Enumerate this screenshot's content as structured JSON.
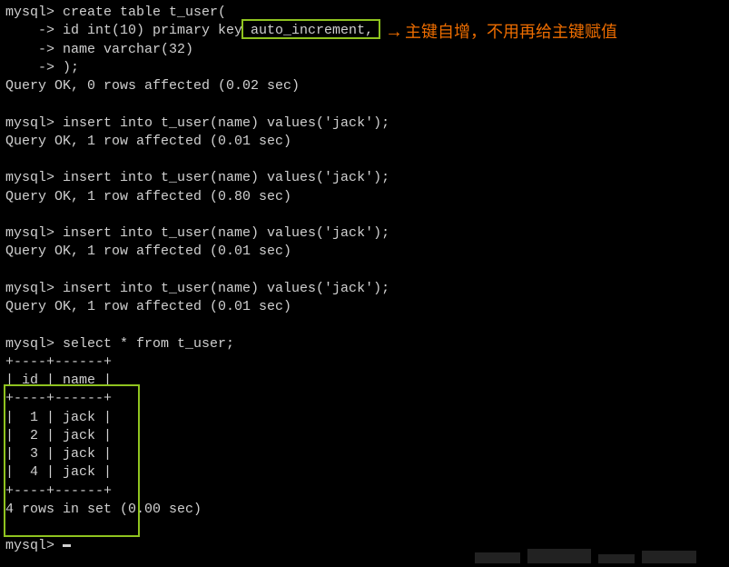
{
  "terminal": {
    "lines": [
      "mysql> create table t_user(",
      "    -> id int(10) primary key auto_increment,",
      "    -> name varchar(32)",
      "    -> );",
      "Query OK, 0 rows affected (0.02 sec)",
      "",
      "mysql> insert into t_user(name) values('jack');",
      "Query OK, 1 row affected (0.01 sec)",
      "",
      "mysql> insert into t_user(name) values('jack');",
      "Query OK, 1 row affected (0.80 sec)",
      "",
      "mysql> insert into t_user(name) values('jack');",
      "Query OK, 1 row affected (0.01 sec)",
      "",
      "mysql> insert into t_user(name) values('jack');",
      "Query OK, 1 row affected (0.01 sec)",
      "",
      "mysql> select * from t_user;",
      "+----+------+",
      "| id | name |",
      "+----+------+",
      "|  1 | jack |",
      "|  2 | jack |",
      "|  3 | jack |",
      "|  4 | jack |",
      "+----+------+",
      "4 rows in set (0.00 sec)",
      "",
      "mysql> "
    ],
    "prompt_final": "mysql> "
  },
  "annotation": {
    "text": "主键自增，不用再给主键赋值",
    "arrow": "→"
  },
  "highlight": {
    "boxed_text": "auto_increment,"
  },
  "chart_data": {
    "type": "table",
    "columns": [
      "id",
      "name"
    ],
    "rows": [
      [
        1,
        "jack"
      ],
      [
        2,
        "jack"
      ],
      [
        3,
        "jack"
      ],
      [
        4,
        "jack"
      ]
    ],
    "summary": "4 rows in set (0.00 sec)"
  }
}
